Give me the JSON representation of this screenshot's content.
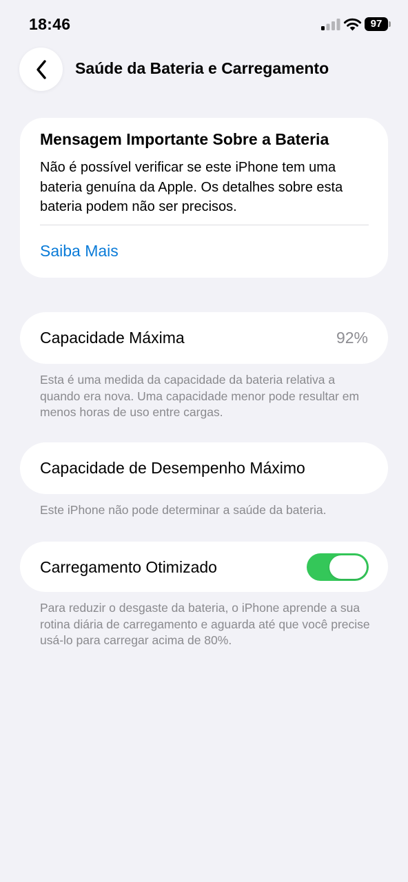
{
  "status_bar": {
    "time": "18:46",
    "battery_level": "97",
    "icons": [
      "signal-icon",
      "wifi-icon",
      "battery-icon"
    ]
  },
  "nav": {
    "back_icon": "chevron-left-icon",
    "title": "Saúde da Bateria e Carregamento"
  },
  "message": {
    "title": "Mensagem Importante Sobre a Bateria",
    "body": "Não é possível verificar se este iPhone tem uma bateria genuína da Apple. Os detalhes sobre esta bateria podem não ser precisos.",
    "link": "Saiba Mais"
  },
  "capacity": {
    "label": "Capacidade Máxima",
    "value": "92%",
    "note": "Esta é uma medida da capacidade da bateria relativa a quando era nova. Uma capacidade menor pode resultar em menos horas de uso entre cargas."
  },
  "performance": {
    "label": "Capacidade de Desempenho Máximo",
    "note": "Este iPhone não pode determinar a saúde da bateria."
  },
  "charging": {
    "label": "Carregamento Otimizado",
    "enabled": true,
    "note": "Para reduzir o desgaste da bateria, o iPhone aprende a sua rotina diária de carregamento e aguarda até que você precise usá-lo para carregar acima de 80%."
  },
  "colors": {
    "background": "#f2f2f7",
    "link": "#0a7bd8",
    "toggle_on": "#34c759",
    "secondary_text": "#8a8a8e"
  }
}
